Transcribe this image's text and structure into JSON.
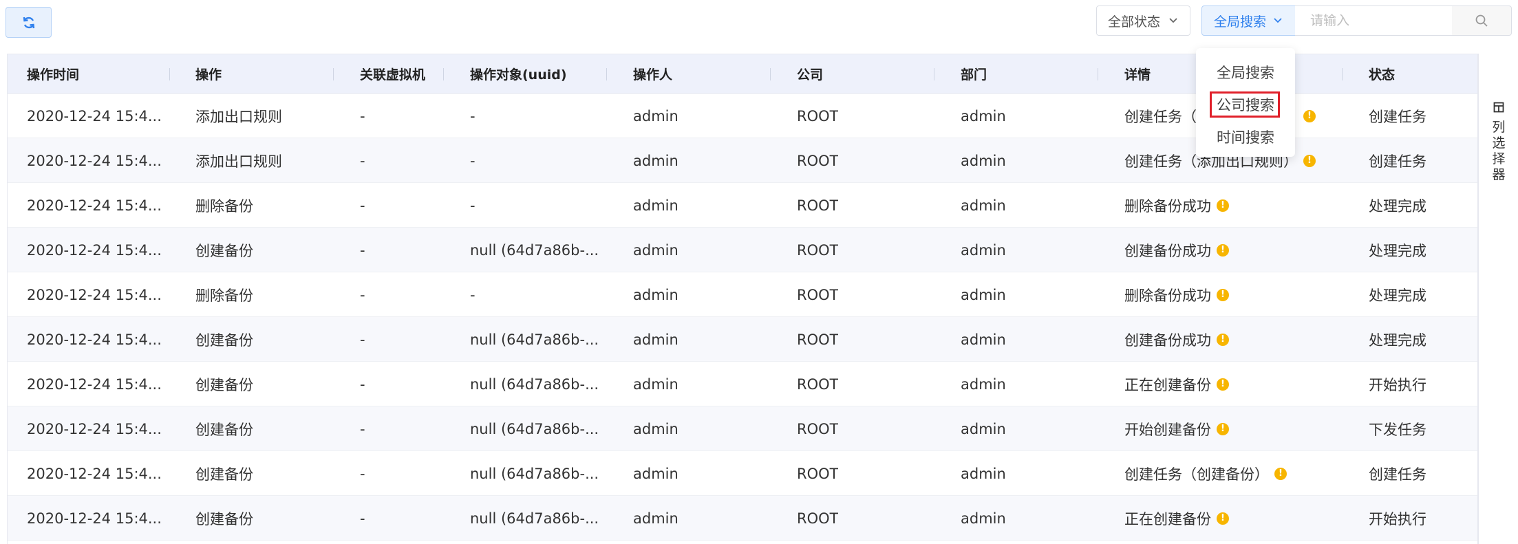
{
  "toolbar": {
    "refresh_icon": "refresh-icon",
    "status_select": "全部状态",
    "search_type": "全局搜索",
    "search_placeholder": "请输入",
    "search_icon": "search-icon",
    "accent": "#2f80ed"
  },
  "dropdown": {
    "options": [
      "全局搜索",
      "公司搜索",
      "时间搜索"
    ],
    "highlighted": "公司搜索",
    "highlight_color": "#e0202a"
  },
  "table": {
    "columns": [
      "操作时间",
      "操作",
      "关联虚拟机",
      "操作对象(uuid)",
      "操作人",
      "公司",
      "部门",
      "详情",
      "状态"
    ],
    "rows": [
      [
        "2020-12-24 15:4...",
        "添加出口规则",
        "-",
        "-",
        "admin",
        "ROOT",
        "admin",
        "创建任务（添加出口规则）",
        "创建任务"
      ],
      [
        "2020-12-24 15:4...",
        "添加出口规则",
        "-",
        "-",
        "admin",
        "ROOT",
        "admin",
        "创建任务（添加出口规则）",
        "创建任务"
      ],
      [
        "2020-12-24 15:4...",
        "删除备份",
        "-",
        "-",
        "admin",
        "ROOT",
        "admin",
        "删除备份成功",
        "处理完成"
      ],
      [
        "2020-12-24 15:4...",
        "创建备份",
        "-",
        "null (64d7a86b-...",
        "admin",
        "ROOT",
        "admin",
        "创建备份成功",
        "处理完成"
      ],
      [
        "2020-12-24 15:4...",
        "删除备份",
        "-",
        "-",
        "admin",
        "ROOT",
        "admin",
        "删除备份成功",
        "处理完成"
      ],
      [
        "2020-12-24 15:4...",
        "创建备份",
        "-",
        "null (64d7a86b-...",
        "admin",
        "ROOT",
        "admin",
        "创建备份成功",
        "处理完成"
      ],
      [
        "2020-12-24 15:4...",
        "创建备份",
        "-",
        "null (64d7a86b-...",
        "admin",
        "ROOT",
        "admin",
        "正在创建备份",
        "开始执行"
      ],
      [
        "2020-12-24 15:4...",
        "创建备份",
        "-",
        "null (64d7a86b-...",
        "admin",
        "ROOT",
        "admin",
        "开始创建备份",
        "下发任务"
      ],
      [
        "2020-12-24 15:4...",
        "创建备份",
        "-",
        "null (64d7a86b-...",
        "admin",
        "ROOT",
        "admin",
        "创建任务（创建备份）",
        "创建任务"
      ],
      [
        "2020-12-24 15:4...",
        "创建备份",
        "-",
        "null (64d7a86b-...",
        "admin",
        "ROOT",
        "admin",
        "正在创建备份",
        "开始执行"
      ]
    ],
    "detail_icon": "warning-icon",
    "warn_color": "#f7b500"
  },
  "column_picker": {
    "label": "列选择器",
    "icon": "columns-icon"
  }
}
